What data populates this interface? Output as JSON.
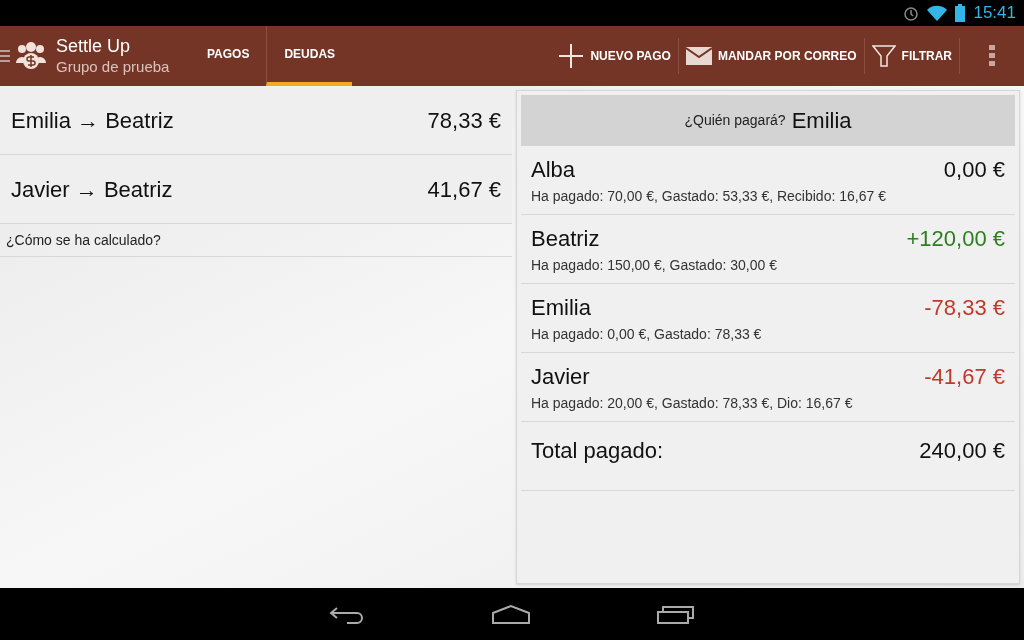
{
  "status_bar": {
    "time": "15:41"
  },
  "app_bar": {
    "title": "Settle Up",
    "subtitle": "Grupo de prueba"
  },
  "tabs": [
    {
      "label": "PAGOS",
      "selected": false
    },
    {
      "label": "DEUDAS",
      "selected": true
    }
  ],
  "actions": [
    {
      "kind": "add",
      "label": "NUEVO PAGO"
    },
    {
      "kind": "mail",
      "label": "MANDAR POR CORREO"
    },
    {
      "kind": "filter",
      "label": "FILTRAR"
    }
  ],
  "debts": [
    {
      "from": "Emilia",
      "arrow": "→",
      "to": "Beatriz",
      "amount": "78,33 €"
    },
    {
      "from": "Javier",
      "arrow": "→",
      "to": "Beatriz",
      "amount": "41,67 €"
    }
  ],
  "how_link": "¿Cómo se ha calculado?",
  "payer": {
    "question": "¿Quién pagará?",
    "name": "Emilia"
  },
  "balances": [
    {
      "name": "Alba",
      "details": "Ha pagado: 70,00 €, Gastado: 53,33 €, Recibido: 16,67 €",
      "amount": "0,00 €",
      "kind": "zero"
    },
    {
      "name": "Beatriz",
      "details": "Ha pagado: 150,00 €, Gastado: 30,00 €",
      "amount": "+120,00 €",
      "kind": "positive"
    },
    {
      "name": "Emilia",
      "details": "Ha pagado: 0,00 €, Gastado: 78,33 €",
      "amount": "-78,33 €",
      "kind": "negative"
    },
    {
      "name": "Javier",
      "details": "Ha pagado: 20,00 €, Gastado: 78,33 €, Dio: 16,67 €",
      "amount": "-41,67 €",
      "kind": "negative"
    }
  ],
  "total": {
    "label": "Total pagado:",
    "amount": "240,00 €"
  }
}
